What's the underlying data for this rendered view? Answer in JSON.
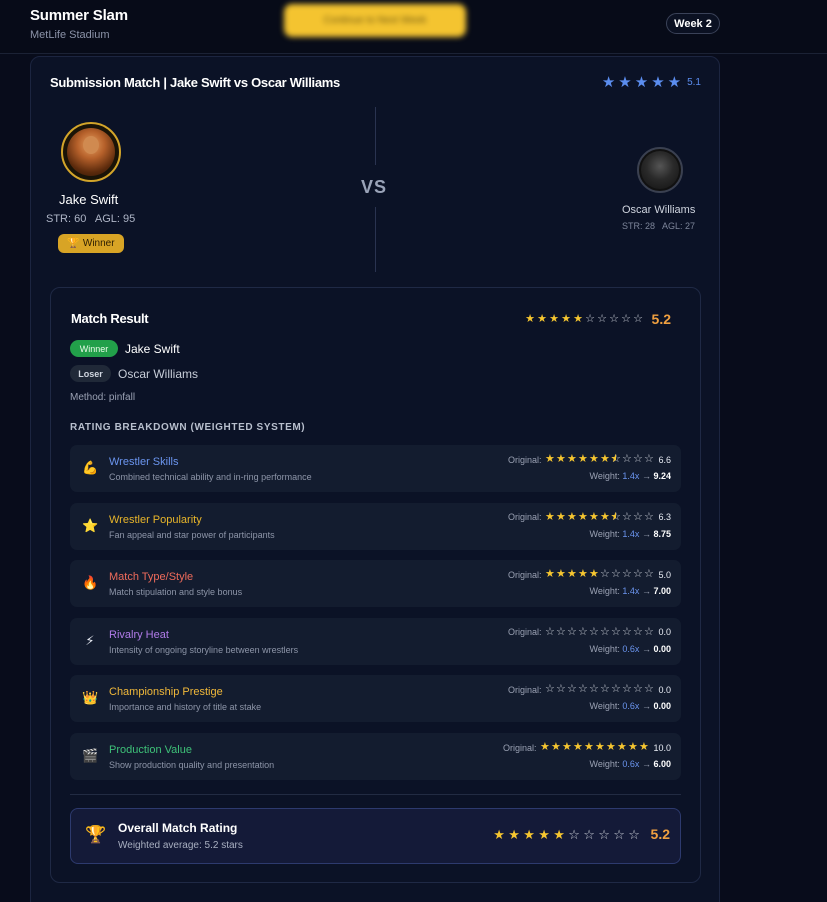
{
  "header": {
    "event_title": "Summer Slam",
    "venue": "MetLife Stadium",
    "continue_label": "Continue to Next Week",
    "week": "Week 2"
  },
  "match": {
    "heading": "Submission Match | Jake Swift vs Oscar Williams",
    "header_rating": "5.1",
    "header_star_count": 5,
    "vs": "VS",
    "wrestler1": {
      "name": "Jake Swift",
      "stats": "STR: 60   AGL: 95",
      "badge": "Winner"
    },
    "wrestler2": {
      "name": "Oscar Williams",
      "stats": "STR: 28   AGL: 27"
    }
  },
  "result": {
    "title": "Match Result",
    "rating": "5.2",
    "rating_fraction": 0.52,
    "winner_pill": "Winner",
    "winner_name": "Jake Swift",
    "loser_pill": "Loser",
    "loser_name": "Oscar Williams",
    "method": "Method: pinfall",
    "breakdown_title": "RATING BREAKDOWN (WEIGHTED SYSTEM)"
  },
  "categories": [
    {
      "name": "Wrestler Skills",
      "desc": "Combined technical ability and in-ring performance",
      "icon": "flexed-biceps-icon",
      "glyph": "💪",
      "color": "#6b95ef",
      "original_label": "Original:",
      "original": "6.6",
      "stars": 6.6,
      "weight_label": "Weight:",
      "weight": "1.4x",
      "arrow": "→",
      "result": "9.24"
    },
    {
      "name": "Wrestler Popularity",
      "desc": "Fan appeal and star power of participants",
      "icon": "star-icon",
      "glyph": "⭐",
      "color": "#e8b52a",
      "original_label": "Original:",
      "original": "6.3",
      "stars": 6.3,
      "weight_label": "Weight:",
      "weight": "1.4x",
      "arrow": "→",
      "result": "8.75"
    },
    {
      "name": "Match Type/Style",
      "desc": "Match stipulation and style bonus",
      "icon": "fire-icon",
      "glyph": "🔥",
      "color": "#ef6b5b",
      "original_label": "Original:",
      "original": "5.0",
      "stars": 5.0,
      "weight_label": "Weight:",
      "weight": "1.4x",
      "arrow": "→",
      "result": "7.00"
    },
    {
      "name": "Rivalry Heat",
      "desc": "Intensity of ongoing storyline between wrestlers",
      "icon": "lightning-icon",
      "glyph": "⚡",
      "color": "#b07be8",
      "original_label": "Original:",
      "original": "0.0",
      "stars": 0,
      "weight_label": "Weight:",
      "weight": "0.6x",
      "arrow": "→",
      "result": "0.00"
    },
    {
      "name": "Championship Prestige",
      "desc": "Importance and history of title at stake",
      "icon": "crown-icon",
      "glyph": "👑",
      "color": "#f0b83a",
      "original_label": "Original:",
      "original": "0.0",
      "stars": 0,
      "weight_label": "Weight:",
      "weight": "0.6x",
      "arrow": "→",
      "result": "0.00"
    },
    {
      "name": "Production Value",
      "desc": "Show production quality and presentation",
      "icon": "clapperboard-icon",
      "glyph": "🎬",
      "color": "#3ec178",
      "original_label": "Original:",
      "original": "10.0",
      "stars": 10,
      "weight_label": "Weight:",
      "weight": "0.6x",
      "arrow": "→",
      "result": "6.00"
    }
  ],
  "overall": {
    "title": "Overall Match Rating",
    "subtitle": "Weighted average: 5.2 stars",
    "rating": "5.2",
    "stars_filled": 5,
    "stars_total": 10,
    "icon": "trophy-icon"
  }
}
